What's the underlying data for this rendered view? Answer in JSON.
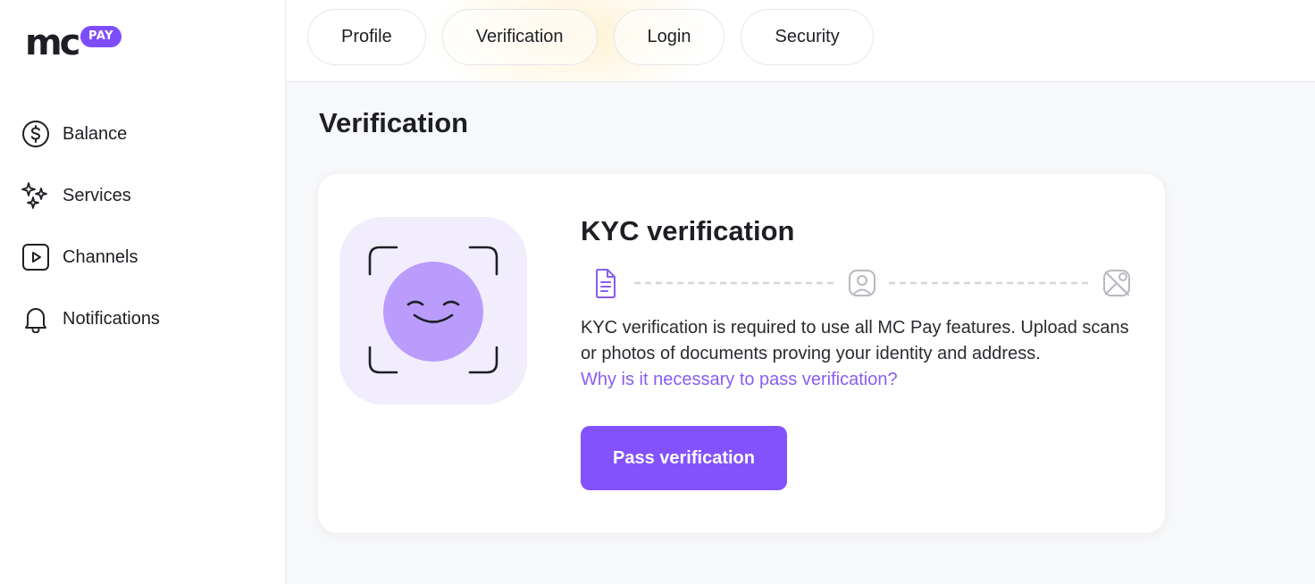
{
  "brand": {
    "name": "mc",
    "badge": "PAY",
    "accent": "#7d4dfc"
  },
  "sidebar": {
    "items": [
      {
        "label": "Balance",
        "icon": "dollar-circle-icon"
      },
      {
        "label": "Services",
        "icon": "sparkles-icon"
      },
      {
        "label": "Channels",
        "icon": "play-square-icon"
      },
      {
        "label": "Notifications",
        "icon": "bell-icon"
      }
    ]
  },
  "tabs": [
    {
      "label": "Profile"
    },
    {
      "label": "Verification",
      "active": true
    },
    {
      "label": "Login"
    },
    {
      "label": "Security"
    }
  ],
  "page": {
    "title": "Verification"
  },
  "kyc": {
    "title": "KYC verification",
    "steps": [
      {
        "icon": "document-icon",
        "state": "active"
      },
      {
        "icon": "user-portrait-icon",
        "state": "pending"
      },
      {
        "icon": "image-off-icon",
        "state": "pending"
      }
    ],
    "description": "KYC verification is required to use all MC Pay features. Upload scans or photos of documents proving your identity and address.",
    "link": "Why is it necessary to pass verification?",
    "button": "Pass verification",
    "illustration_icon": "face-scan-icon"
  },
  "colors": {
    "primary": "#8352fd",
    "link": "#8a5cf0",
    "illustration_bg": "#f1edfd",
    "face": "#b99cfc"
  }
}
